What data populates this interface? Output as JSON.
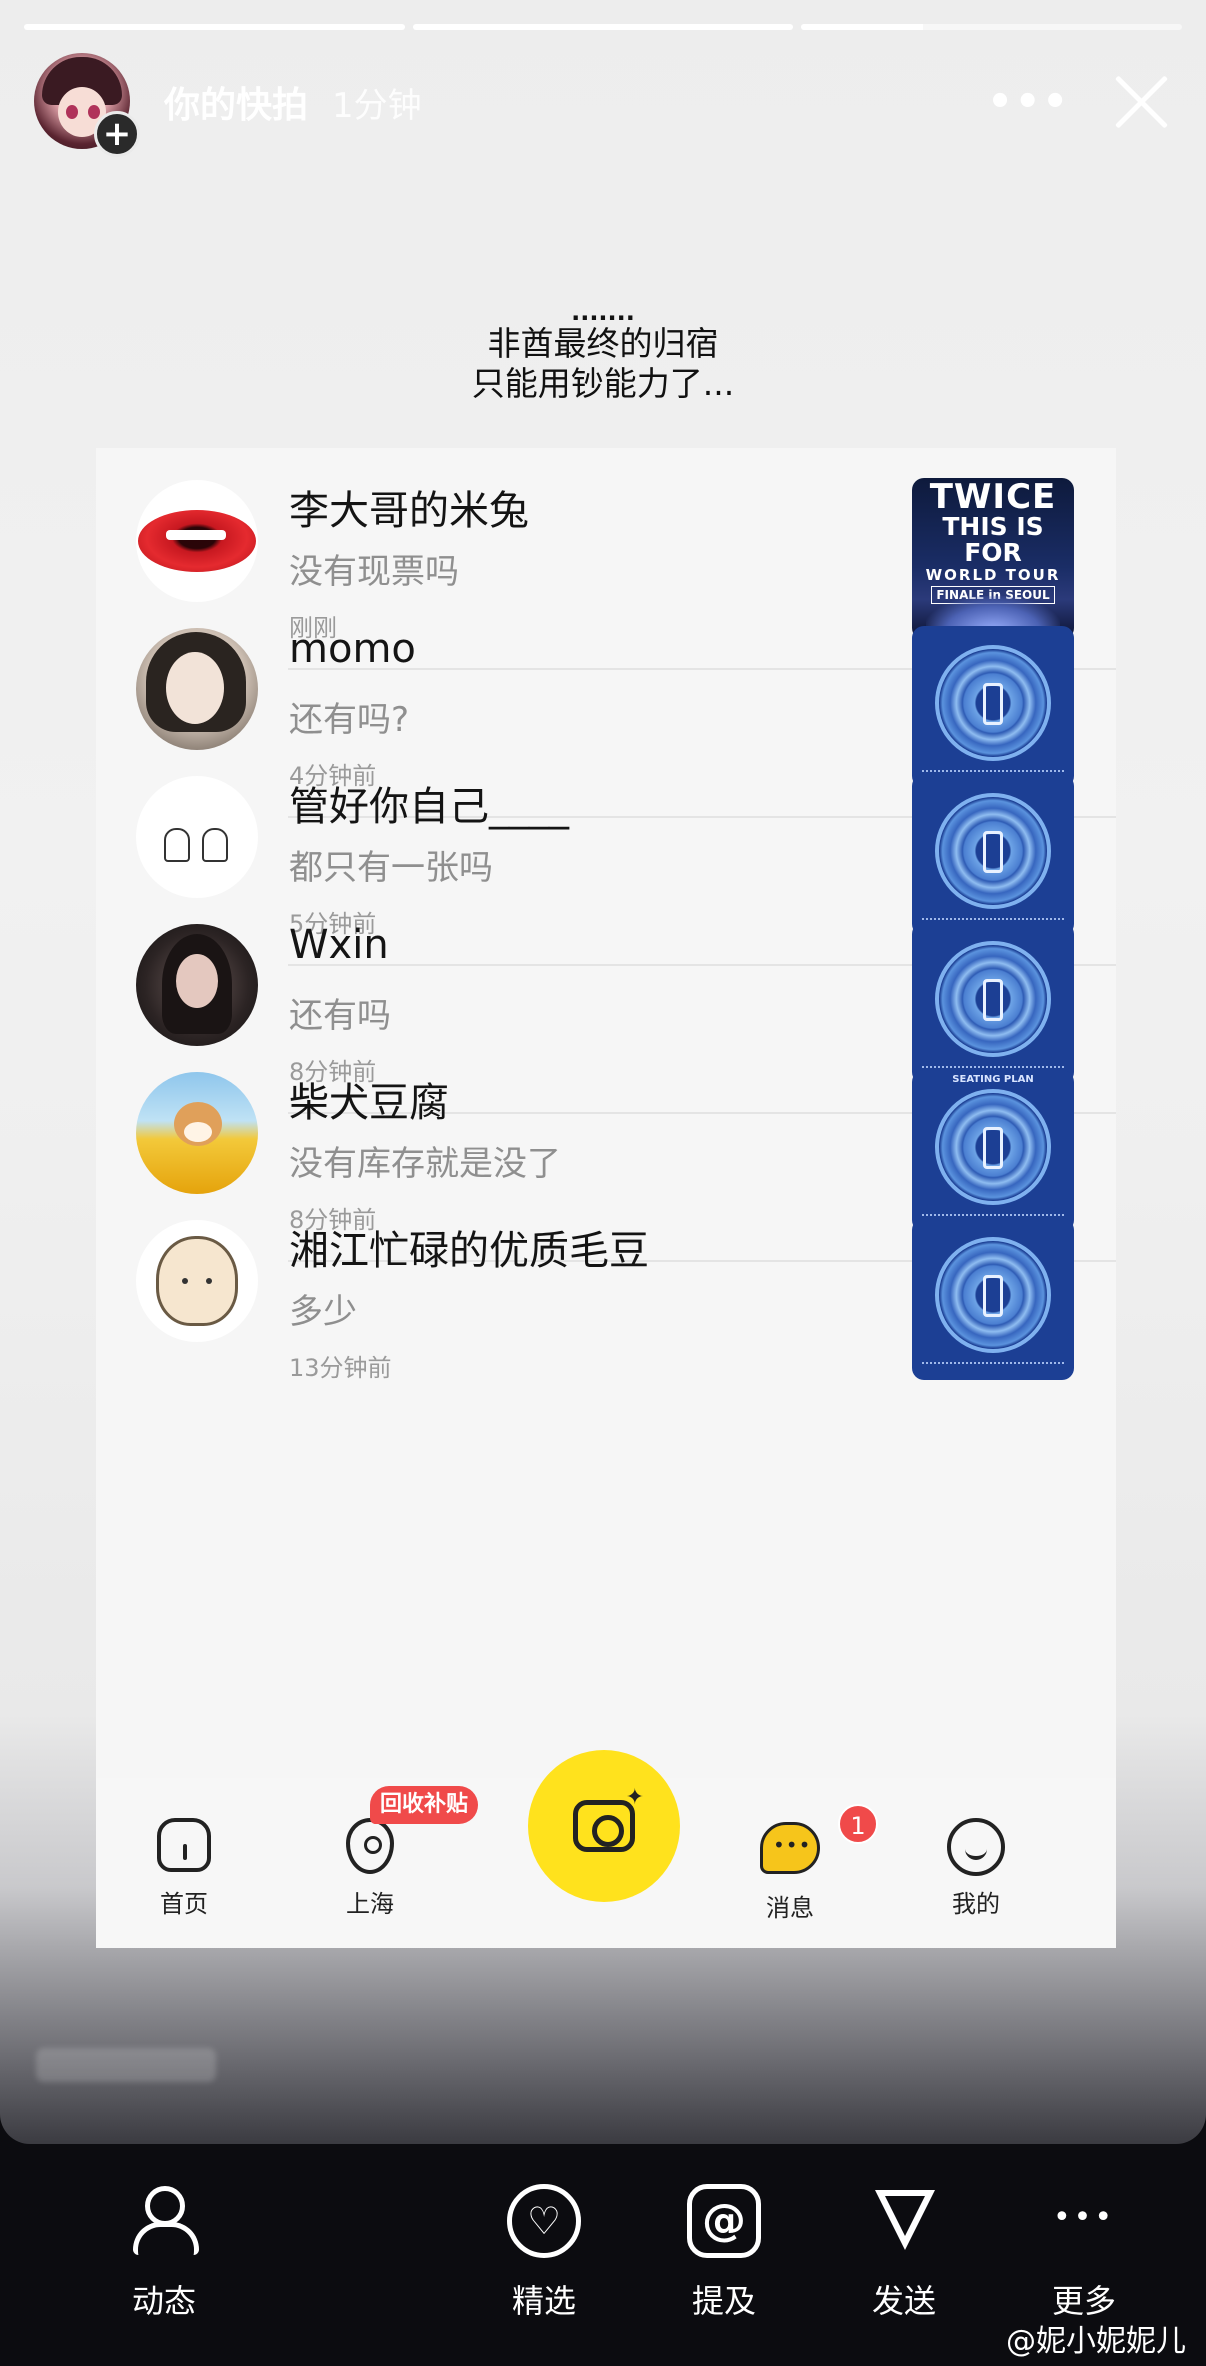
{
  "story": {
    "owner": "你的快拍",
    "time": "1分钟",
    "more_icon": "more-dots-icon",
    "close_icon": "close-icon",
    "progress": [
      1.0,
      1.0,
      0.32
    ],
    "caption": {
      "dots": ".......",
      "line1": "非酋最终的归宿",
      "line2": "只能用钞能力了..."
    }
  },
  "messages": [
    {
      "name": "李大哥的米兔",
      "text": "没有现票吗",
      "time": "刚刚",
      "avatar": "lips-avatar",
      "thumb": "twice-poster"
    },
    {
      "name": "momo",
      "text": "还有吗?",
      "time": "4分钟前",
      "avatar": "girl-avatar",
      "thumb": "seating-plan"
    },
    {
      "name": "管好你自己____",
      "text": "都只有一张吗",
      "time": "5分钟前",
      "avatar": "sketch-avatar",
      "thumb": "seating-plan"
    },
    {
      "name": "Wxin",
      "text": "还有吗",
      "time": "8分钟前",
      "avatar": "girl-avatar",
      "thumb": "seating-plan"
    },
    {
      "name": "柴犬豆腐",
      "text": "没有库存就是没了",
      "time": "8分钟前",
      "avatar": "shiba-avatar",
      "thumb": "seating-plan"
    },
    {
      "name": "湘江忙碌的优质毛豆",
      "text": "多少",
      "time": "13分钟前",
      "avatar": "bun-avatar",
      "thumb": "seating-plan"
    }
  ],
  "twice_poster": {
    "line1": "TWICE",
    "line2": "THIS IS FOR",
    "line3": "WORLD TOUR",
    "line4": "FINALE in SEOUL"
  },
  "seating_tag": "SEATING PLAN",
  "inner_nav": {
    "home": "首页",
    "city": "上海",
    "promo": "回收补贴",
    "messages": "消息",
    "messages_badge": "1",
    "me": "我的"
  },
  "actions": {
    "activity": "动态",
    "featured": "精选",
    "mention": "提及",
    "send": "发送",
    "more": "更多"
  },
  "watermark": "@妮小妮妮儿",
  "colors": {
    "accent_yellow": "#ffe21d",
    "badge_red": "#f04a4a",
    "bar_bg": "#0c0c10"
  }
}
